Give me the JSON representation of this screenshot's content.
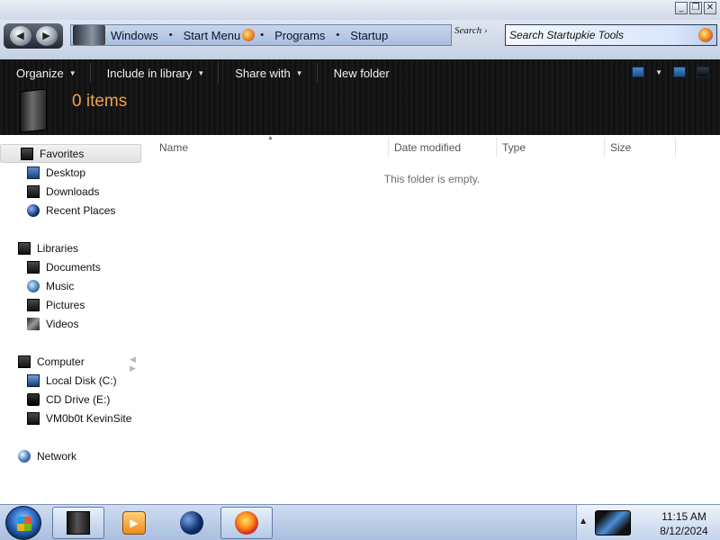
{
  "window": {
    "controls": {
      "minimize": "_",
      "restore": "❐",
      "close": "✕"
    }
  },
  "address_bar": {
    "crumbs": [
      "Windows",
      "Start Menu",
      "Programs",
      "Startup"
    ],
    "separator": "•",
    "refresh_label": "Search ›"
  },
  "search": {
    "placeholder": "Search Startupkie Tools"
  },
  "toolbar": {
    "organize_label": "Organize",
    "include_label": "Include in library",
    "share_label": "Share with",
    "new_folder_label": "New folder",
    "caret": "▼"
  },
  "header": {
    "item_count": "0 items"
  },
  "nav": {
    "favorites": {
      "label": "Favorites",
      "items": [
        "Desktop",
        "Downloads",
        "Recent Places"
      ]
    },
    "libraries": {
      "label": "Libraries",
      "items": [
        "Documents",
        "Music",
        "Pictures",
        "Videos"
      ]
    },
    "computer": {
      "label": "Computer",
      "items": [
        "Local Disk (C:)",
        "CD Drive (E:)",
        "VM0b0t KevinSite"
      ]
    },
    "network": {
      "label": "Network"
    },
    "arrows": "◀ ▶"
  },
  "columns": {
    "name": "Name",
    "date_modified": "Date modified",
    "type": "Type",
    "size": "Size",
    "sort_caret": "▲"
  },
  "content": {
    "empty_message": "This folder is empty."
  },
  "taskbar": {
    "tray_arrow": "▲",
    "clock_time": "11:15 AM",
    "clock_date": "8/12/2024",
    "media_glyph": "▶"
  },
  "icons": {
    "favorites": "star-icon",
    "desktop": "desktop-icon",
    "downloads": "downloads-icon",
    "recent": "recent-places-icon",
    "libraries": "libraries-icon",
    "documents": "documents-icon",
    "music": "music-icon",
    "pictures": "pictures-icon",
    "videos": "videos-icon",
    "computer": "computer-icon",
    "disk": "hard-disk-icon",
    "cd": "cd-drive-icon",
    "network_drive": "network-drive-icon",
    "network": "network-icon"
  },
  "colors": {
    "accent_count": "#f0a24a",
    "toolbar_bg": "#141414",
    "taskbar_bg": "#b9cce6"
  }
}
